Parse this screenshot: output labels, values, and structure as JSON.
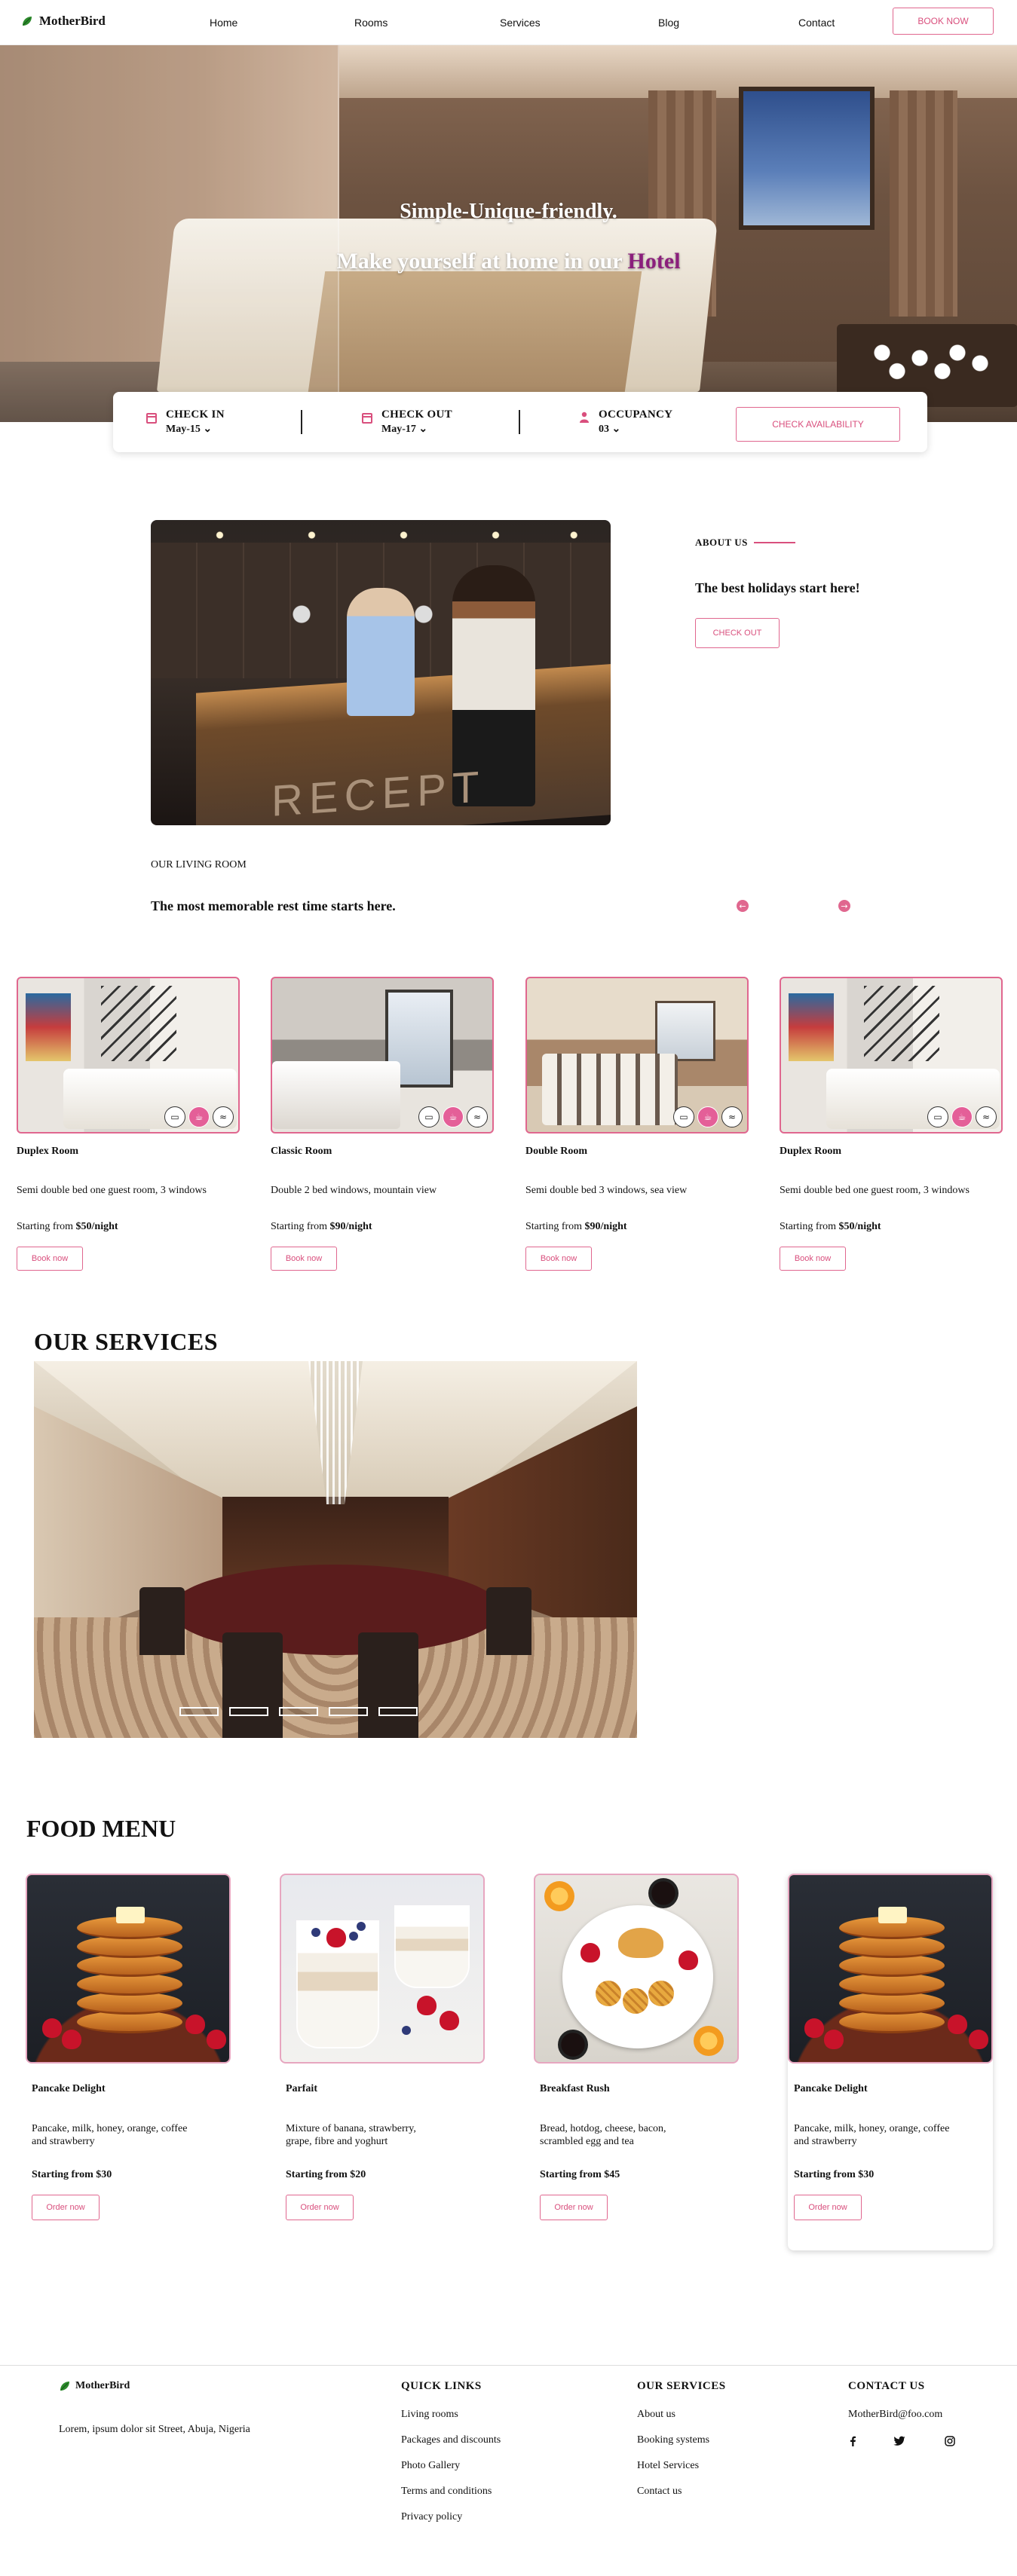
{
  "nav": {
    "brand": "MotherBird",
    "links": [
      "Home",
      "Rooms",
      "Services",
      "Blog",
      "Contact"
    ],
    "cta": "BOOK NOW"
  },
  "hero": {
    "line1": "Simple-Unique-friendly.",
    "line2_prefix": "Make yourself at home in our ",
    "line2_highlight": "Hotel"
  },
  "booking": {
    "checkin_label": "CHECK IN",
    "checkin_value": "May-15",
    "checkout_label": "CHECK OUT",
    "checkout_value": "May-17",
    "occupancy_label": "OCCUPANCY",
    "occupancy_value": "03",
    "cta": "CHECK AVAILABILITY"
  },
  "about": {
    "label": "ABOUT US",
    "title": "The best holidays start here!",
    "cta": "CHECK OUT"
  },
  "living": {
    "label": "OUR LIVING ROOM",
    "title": "The most memorable rest time starts here."
  },
  "rooms": [
    {
      "name": "Duplex Room",
      "desc": "Semi double bed one guest room, 3 windows",
      "price_prefix": "Starting from ",
      "price": "$50/night",
      "cta": "Book now"
    },
    {
      "name": "Classic Room",
      "desc": "Double 2 bed windows, mountain view",
      "price_prefix": "Starting from ",
      "price": "$90/night",
      "cta": "Book now"
    },
    {
      "name": "Double Room",
      "desc": "Semi double bed 3 windows, sea view",
      "price_prefix": "Starting from ",
      "price": "$90/night",
      "cta": "Book now"
    },
    {
      "name": "Duplex Room",
      "desc": "Semi double bed one guest room, 3 windows",
      "price_prefix": "Starting from ",
      "price": "$50/night",
      "cta": "Book now"
    }
  ],
  "services": {
    "title": "OUR SERVICES"
  },
  "food": {
    "title": "FOOD MENU",
    "items": [
      {
        "name": "Pancake Delight",
        "desc": "Pancake, milk, honey, orange, coffee and strawberry",
        "price": "Starting from $30",
        "cta": "Order now"
      },
      {
        "name": "Parfait",
        "desc": "Mixture of banana, strawberry, grape, fibre and yoghurt",
        "price": "Starting from $20",
        "cta": "Order now"
      },
      {
        "name": "Breakfast Rush",
        "desc": "Bread, hotdog, cheese, bacon, scrambled egg and tea",
        "price": "Starting from $45",
        "cta": "Order now"
      },
      {
        "name": "Pancake Delight",
        "desc": "Pancake, milk, honey, orange, coffee and strawberry",
        "price": "Starting from $30",
        "cta": "Order now"
      }
    ]
  },
  "footer": {
    "brand": "MotherBird",
    "address": "Lorem, ipsum dolor sit Street, Abuja, Nigeria",
    "quick_links_title": "QUICK LINKS",
    "quick_links": [
      "Living rooms",
      "Packages and discounts",
      "Photo Gallery",
      "Terms and conditions",
      "Privacy policy"
    ],
    "services_title": "OUR SERVICES",
    "services": [
      "About us",
      "Booking systems",
      "Hotel Services",
      "Contact us"
    ],
    "contact_title": "CONTACT US",
    "email": "MotherBird@foo.com"
  },
  "colors": {
    "accent": "#d94f7d",
    "highlight": "#8b1f7c"
  }
}
